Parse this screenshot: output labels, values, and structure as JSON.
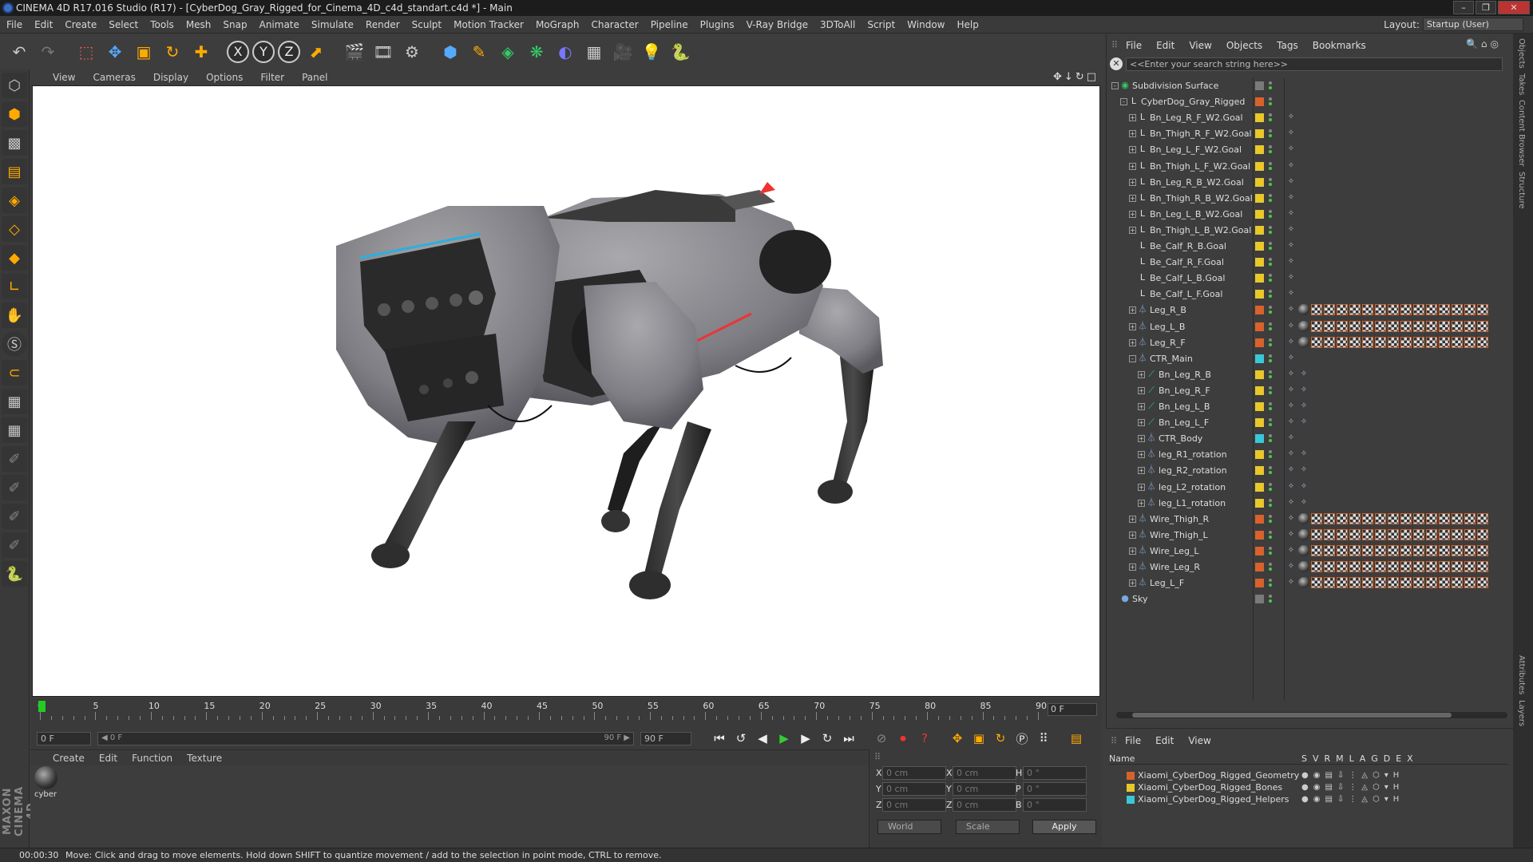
{
  "window": {
    "title": "CINEMA 4D R17.016 Studio (R17) - [CyberDog_Gray_Rigged_for_Cinema_4D_c4d_standart.c4d *] - Main",
    "controls": [
      "–",
      "❐",
      "✕"
    ]
  },
  "menubar": {
    "items": [
      "File",
      "Edit",
      "Create",
      "Select",
      "Tools",
      "Mesh",
      "Snap",
      "Animate",
      "Simulate",
      "Render",
      "Sculpt",
      "Motion Tracker",
      "MoGraph",
      "Character",
      "Pipeline",
      "Plugins",
      "V-Ray Bridge",
      "3DToAll",
      "Script",
      "Window",
      "Help"
    ],
    "layout_label": "Layout:",
    "layout_value": "Startup (User)"
  },
  "toolbar": {
    "icons": [
      "undo-icon",
      "redo-icon",
      "select-icon",
      "move-icon",
      "scale-icon",
      "rotate-icon",
      "add-icon",
      "x-axis-icon",
      "y-axis-icon",
      "z-axis-icon",
      "coord-icon",
      "render-view-icon",
      "render-pic-icon",
      "render-settings-icon",
      "cube-icon",
      "pen-icon",
      "subdivision-icon",
      "array-icon",
      "deformer-icon",
      "floor-icon",
      "camera-icon",
      "light-icon",
      "python-icon"
    ],
    "axis_labels": [
      "X",
      "Y",
      "Z"
    ]
  },
  "viewport": {
    "menu": [
      "View",
      "Cameras",
      "Display",
      "Options",
      "Filter",
      "Panel"
    ],
    "nav_glyphs": "✥↓↻□"
  },
  "timeline": {
    "ticks": [
      "0",
      "5",
      "10",
      "15",
      "20",
      "25",
      "30",
      "35",
      "40",
      "45",
      "50",
      "55",
      "60",
      "65",
      "70",
      "75",
      "80",
      "85",
      "90"
    ],
    "current_frame": "0 F",
    "start_frame": "0 F",
    "range_start": "◀ 0 F",
    "range_end": "90 F ▶",
    "end_frame": "90 F"
  },
  "materials": {
    "menu": [
      "Create",
      "Edit",
      "Function",
      "Texture"
    ],
    "items": [
      {
        "label": "cyber"
      }
    ]
  },
  "coordinates": {
    "rows": [
      {
        "a": "X",
        "av": "0 cm",
        "b": "X",
        "bv": "0 cm",
        "c": "H",
        "cv": "0 °"
      },
      {
        "a": "Y",
        "av": "0 cm",
        "b": "Y",
        "bv": "0 cm",
        "c": "P",
        "cv": "0 °"
      },
      {
        "a": "Z",
        "av": "0 cm",
        "b": "Z",
        "bv": "0 cm",
        "c": "B",
        "cv": "0 °"
      }
    ],
    "mode": "World",
    "mode2": "Scale",
    "apply": "Apply"
  },
  "status": {
    "time": "00:00:30",
    "message": "Move: Click and drag to move elements. Hold down SHIFT to quantize movement / add to the selection in point mode, CTRL to remove."
  },
  "branding": "MAXON CINEMA 4D",
  "object_manager": {
    "menu": [
      "File",
      "Edit",
      "View",
      "Objects",
      "Tags",
      "Bookmarks"
    ],
    "search_placeholder": "<<Enter your search string here>>",
    "objects": [
      {
        "name": "Subdivision Surface",
        "depth": 0,
        "icon": "sub",
        "color": "#7a7a7a",
        "exp": "-",
        "tags": []
      },
      {
        "name": "CyberDog_Gray_Rigged",
        "depth": 1,
        "icon": "null",
        "color": "#d8622c",
        "exp": "-",
        "tags": []
      },
      {
        "name": "Bn_Leg_R_F_W2.Goal",
        "depth": 2,
        "icon": "null",
        "color": "#e8c82a",
        "exp": "+",
        "tags": [
          "ik"
        ]
      },
      {
        "name": "Bn_Thigh_R_F_W2.Goal",
        "depth": 2,
        "icon": "null",
        "color": "#e8c82a",
        "exp": "+",
        "tags": [
          "ik"
        ]
      },
      {
        "name": "Bn_Leg_L_F_W2.Goal",
        "depth": 2,
        "icon": "null",
        "color": "#e8c82a",
        "exp": "+",
        "tags": [
          "ik"
        ]
      },
      {
        "name": "Bn_Thigh_L_F_W2.Goal",
        "depth": 2,
        "icon": "null",
        "color": "#e8c82a",
        "exp": "+",
        "tags": [
          "ik"
        ]
      },
      {
        "name": "Bn_Leg_R_B_W2.Goal",
        "depth": 2,
        "icon": "null",
        "color": "#e8c82a",
        "exp": "+",
        "tags": [
          "ik"
        ]
      },
      {
        "name": "Bn_Thigh_R_B_W2.Goal",
        "depth": 2,
        "icon": "null",
        "color": "#e8c82a",
        "exp": "+",
        "tags": [
          "ik"
        ]
      },
      {
        "name": "Bn_Leg_L_B_W2.Goal",
        "depth": 2,
        "icon": "null",
        "color": "#e8c82a",
        "exp": "+",
        "tags": [
          "ik"
        ]
      },
      {
        "name": "Bn_Thigh_L_B_W2.Goal",
        "depth": 2,
        "icon": "null",
        "color": "#e8c82a",
        "exp": "+",
        "tags": [
          "ik"
        ]
      },
      {
        "name": "Be_Calf_R_B.Goal",
        "depth": 2,
        "icon": "null",
        "color": "#e8c82a",
        "exp": "",
        "tags": [
          "ik"
        ]
      },
      {
        "name": "Be_Calf_R_F.Goal",
        "depth": 2,
        "icon": "null",
        "color": "#e8c82a",
        "exp": "",
        "tags": [
          "ik"
        ]
      },
      {
        "name": "Be_Calf_L_B.Goal",
        "depth": 2,
        "icon": "null",
        "color": "#e8c82a",
        "exp": "",
        "tags": [
          "ik"
        ]
      },
      {
        "name": "Be_Calf_L_F.Goal",
        "depth": 2,
        "icon": "null",
        "color": "#e8c82a",
        "exp": "",
        "tags": [
          "ik"
        ]
      },
      {
        "name": "Leg_R_B",
        "depth": 2,
        "icon": "mesh",
        "color": "#d8622c",
        "exp": "+",
        "tags": [
          "ik",
          "mat",
          "chk"
        ]
      },
      {
        "name": "Leg_L_B",
        "depth": 2,
        "icon": "mesh",
        "color": "#d8622c",
        "exp": "+",
        "tags": [
          "ik",
          "mat",
          "chk"
        ]
      },
      {
        "name": "Leg_R_F",
        "depth": 2,
        "icon": "mesh",
        "color": "#d8622c",
        "exp": "+",
        "tags": [
          "ik",
          "mat",
          "chk"
        ]
      },
      {
        "name": "CTR_Main",
        "depth": 2,
        "icon": "mesh",
        "color": "#3ac8d8",
        "exp": "-",
        "tags": [
          "ik"
        ]
      },
      {
        "name": "Bn_Leg_R_B",
        "depth": 3,
        "icon": "bone",
        "color": "#e8c82a",
        "exp": "+",
        "tags": [
          "ik",
          "ik"
        ]
      },
      {
        "name": "Bn_Leg_R_F",
        "depth": 3,
        "icon": "bone",
        "color": "#e8c82a",
        "exp": "+",
        "tags": [
          "ik",
          "ik"
        ]
      },
      {
        "name": "Bn_Leg_L_B",
        "depth": 3,
        "icon": "bone",
        "color": "#e8c82a",
        "exp": "+",
        "tags": [
          "ik",
          "ik"
        ]
      },
      {
        "name": "Bn_Leg_L_F",
        "depth": 3,
        "icon": "bone",
        "color": "#e8c82a",
        "exp": "+",
        "tags": [
          "ik",
          "ik"
        ]
      },
      {
        "name": "CTR_Body",
        "depth": 3,
        "icon": "mesh",
        "color": "#3ac8d8",
        "exp": "+",
        "tags": [
          "ik"
        ]
      },
      {
        "name": "leg_R1_rotation",
        "depth": 3,
        "icon": "mesh",
        "color": "#e8c82a",
        "exp": "+",
        "tags": [
          "ik",
          "ik"
        ]
      },
      {
        "name": "leg_R2_rotation",
        "depth": 3,
        "icon": "mesh",
        "color": "#e8c82a",
        "exp": "+",
        "tags": [
          "ik",
          "ik"
        ]
      },
      {
        "name": "leg_L2_rotation",
        "depth": 3,
        "icon": "mesh",
        "color": "#e8c82a",
        "exp": "+",
        "tags": [
          "ik",
          "ik"
        ]
      },
      {
        "name": "leg_L1_rotation",
        "depth": 3,
        "icon": "mesh",
        "color": "#e8c82a",
        "exp": "+",
        "tags": [
          "ik",
          "ik"
        ]
      },
      {
        "name": "Wire_Thigh_R",
        "depth": 2,
        "icon": "mesh",
        "color": "#d8622c",
        "exp": "+",
        "tags": [
          "ik",
          "mat",
          "chk"
        ]
      },
      {
        "name": "Wire_Thigh_L",
        "depth": 2,
        "icon": "mesh",
        "color": "#d8622c",
        "exp": "+",
        "tags": [
          "ik",
          "mat",
          "chk"
        ]
      },
      {
        "name": "Wire_Leg_L",
        "depth": 2,
        "icon": "mesh",
        "color": "#d8622c",
        "exp": "+",
        "tags": [
          "ik",
          "mat",
          "chk"
        ]
      },
      {
        "name": "Wire_Leg_R",
        "depth": 2,
        "icon": "mesh",
        "color": "#d8622c",
        "exp": "+",
        "tags": [
          "ik",
          "mat",
          "chk"
        ]
      },
      {
        "name": "Leg_L_F",
        "depth": 2,
        "icon": "mesh",
        "color": "#d8622c",
        "exp": "+",
        "tags": [
          "ik",
          "mat",
          "chk"
        ]
      },
      {
        "name": "Sky",
        "depth": 0,
        "icon": "sky",
        "color": "#7a7a7a",
        "exp": "",
        "tags": []
      }
    ]
  },
  "side_tabs": [
    "Objects",
    "Takes",
    "Content Browser",
    "Structure",
    "Attributes",
    "Layers"
  ],
  "layer_manager": {
    "menu": [
      "File",
      "Edit",
      "View"
    ],
    "header_name": "Name",
    "header_cols": "S  V  R  M  L  A  G  D  E  X",
    "layers": [
      {
        "name": "Xiaomi_CyberDog_Rigged_Geometry",
        "color": "#d8622c"
      },
      {
        "name": "Xiaomi_CyberDog_Rigged_Bones",
        "color": "#e8c82a"
      },
      {
        "name": "Xiaomi_CyberDog_Rigged_Helpers",
        "color": "#3ac8d8"
      }
    ]
  }
}
